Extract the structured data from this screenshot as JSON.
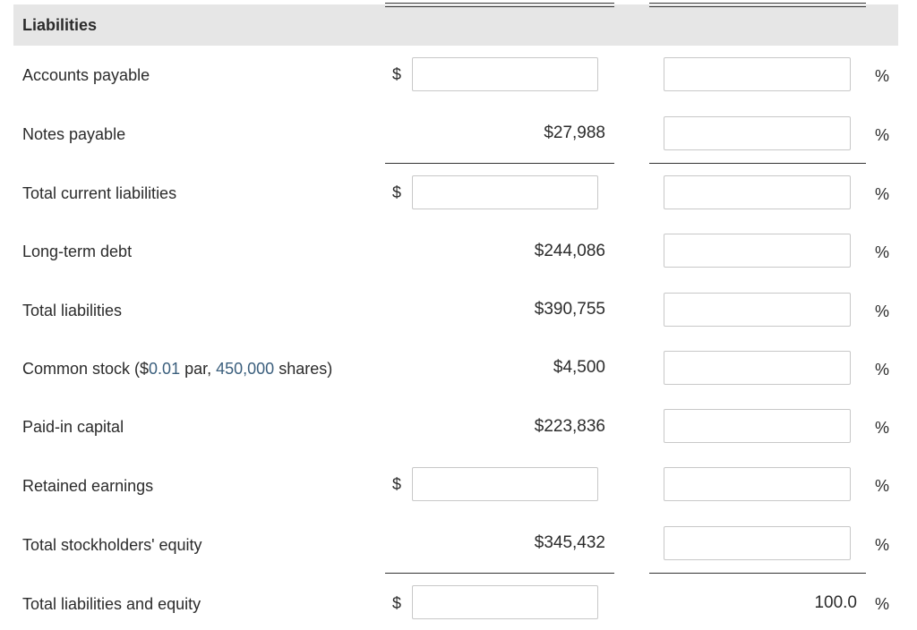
{
  "section": {
    "title": "Liabilities"
  },
  "rows": [
    {
      "label": "Accounts payable",
      "dollar": "$",
      "amount": "",
      "pct": "",
      "pct_sign": "%"
    },
    {
      "label": "Notes payable",
      "amount_text": "$27,988",
      "pct": "",
      "pct_sign": "%"
    },
    {
      "label": "Total current liabilities",
      "dollar": "$",
      "amount": "",
      "pct": "",
      "pct_sign": "%"
    },
    {
      "label": "Long-term debt",
      "amount_text": "$244,086",
      "pct": "",
      "pct_sign": "%"
    },
    {
      "label": "Total liabilities",
      "amount_text": "$390,755",
      "pct": "",
      "pct_sign": "%"
    },
    {
      "label_prefix": "Common stock ($",
      "label_par": "0.01",
      "label_mid": " par, ",
      "label_shares": "450,000",
      "label_suffix": " shares)",
      "amount_text": "$4,500",
      "pct": "",
      "pct_sign": "%"
    },
    {
      "label": "Paid-in capital",
      "amount_text": "$223,836",
      "pct": "",
      "pct_sign": "%"
    },
    {
      "label": "Retained earnings",
      "dollar": "$",
      "amount": "",
      "pct": "",
      "pct_sign": "%"
    },
    {
      "label": "Total stockholders' equity",
      "amount_text": "$345,432",
      "pct": "",
      "pct_sign": "%"
    },
    {
      "label": "Total liabilities and equity",
      "dollar": "$",
      "amount": "",
      "pct_text": "100.0",
      "pct_sign": "%"
    }
  ]
}
